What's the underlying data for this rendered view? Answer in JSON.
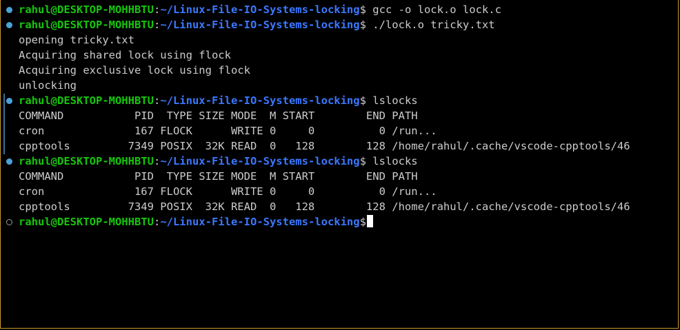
{
  "prompt": {
    "user_host": "rahul@DESKTOP-MOHHBTU",
    "colon": ":",
    "path": "~/Linux-File-IO-Systems-locking",
    "dollar": "$"
  },
  "lines": {
    "l1_cmd": " gcc -o lock.o lock.c",
    "l2_cmd": " ./lock.o tricky.txt",
    "l3": "opening tricky.txt",
    "l4": "Acquiring shared lock using flock",
    "l5": "Acquiring exclusive lock using flock",
    "l6": "unlocking",
    "l7_cmd": " lslocks",
    "l8": "COMMAND           PID  TYPE SIZE MODE  M START        END PATH",
    "l9": "cron              167 FLOCK      WRITE 0     0          0 /run...",
    "l10": "cpptools         7349 POSIX  32K READ  0   128        128 /home/rahul/.cache/vscode-cpptools/46",
    "l11_cmd": " lslocks",
    "l12": "COMMAND           PID  TYPE SIZE MODE  M START        END PATH",
    "l13": "cron              167 FLOCK      WRITE 0     0          0 /run...",
    "l14": "cpptools         7349 POSIX  32K READ  0   128        128 /home/rahul/.cache/vscode-cpptools/46",
    "l15_cmd": ""
  },
  "colors": {
    "user": "#16c60c",
    "path": "#3b78ff",
    "text": "#cccccc",
    "border": "#c89b2e",
    "marker": "#4aa3d8"
  }
}
